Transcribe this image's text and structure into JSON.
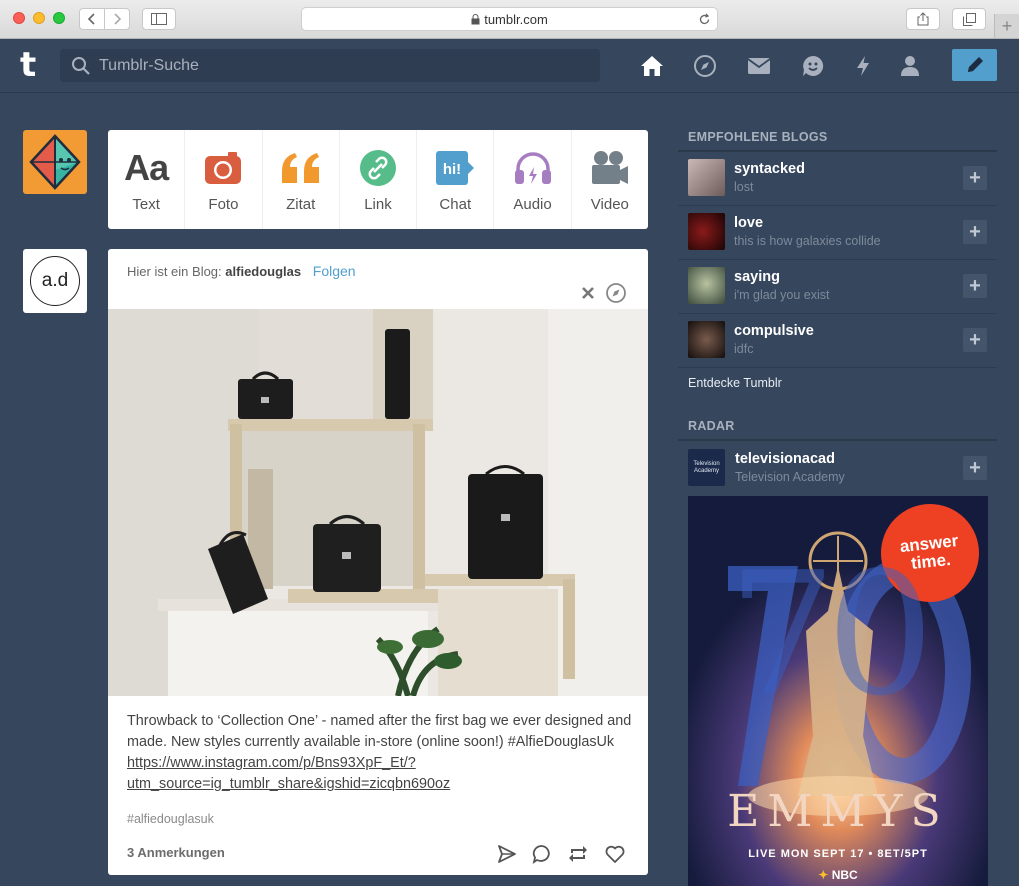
{
  "browser": {
    "url": "tumblr.com"
  },
  "header": {
    "search_placeholder": "Tumblr-Suche"
  },
  "post_types": [
    {
      "label": "Text",
      "icon": "text-icon",
      "color": "#444444"
    },
    {
      "label": "Foto",
      "icon": "camera-icon",
      "color": "#d95e40"
    },
    {
      "label": "Zitat",
      "icon": "quote-icon",
      "color": "#f2992e"
    },
    {
      "label": "Link",
      "icon": "link-icon",
      "color": "#56bc8a"
    },
    {
      "label": "Chat",
      "icon": "chat-icon",
      "color": "#529ecc"
    },
    {
      "label": "Audio",
      "icon": "headphones-icon",
      "color": "#a77dc2"
    },
    {
      "label": "Video",
      "icon": "video-icon",
      "color": "#748089"
    }
  ],
  "post": {
    "intro": "Hier ist ein Blog:",
    "blog": "alfiedouglas",
    "follow": "Folgen",
    "avatar_text": "a.d",
    "caption": "Throwback to ‘Collection One’ - named after the first bag we ever designed and made. New styles currently available in-store (online soon!) #AlfieDouglasUk",
    "link_line1": "https://www.instagram.com/p/Bns93XpF_Et/?",
    "link_line2": "utm_source=ig_tumblr_share&igshid=zicqbn690oz",
    "tag": "#alfiedouglasuk",
    "notes": "3 Anmerkungen"
  },
  "sidebar": {
    "recommended_heading": "EMPFOHLENE BLOGS",
    "blogs": [
      {
        "name": "syntacked",
        "sub": "lost"
      },
      {
        "name": "love",
        "sub": "this is how galaxies collide"
      },
      {
        "name": "saying",
        "sub": "i'm glad you exist"
      },
      {
        "name": "compulsive",
        "sub": "idfc"
      }
    ],
    "explore": "Entdecke Tumblr",
    "radar_heading": "RADAR",
    "radar": {
      "name": "televisionacad",
      "sub": "Television Academy",
      "avatar_text": "Television Academy"
    },
    "ad": {
      "sticker_line1": "answer",
      "sticker_line2": "time.",
      "number": "70",
      "title": "EMMYS",
      "date": "LIVE MON SEPT 17 • 8ET/5PT",
      "network": "NBC"
    }
  }
}
